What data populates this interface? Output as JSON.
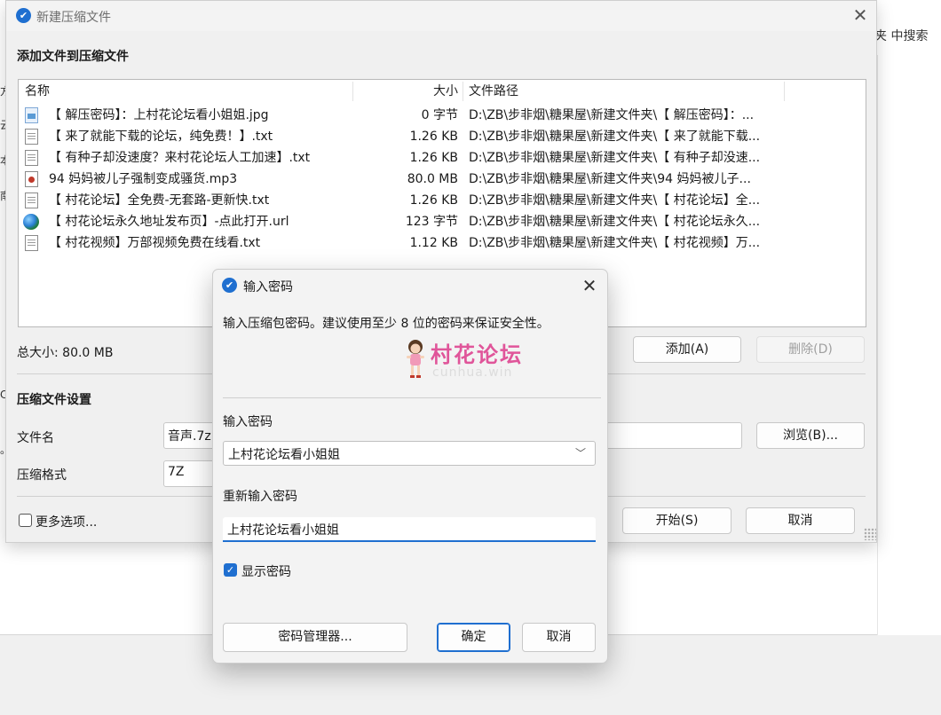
{
  "background": {
    "search_text": "夹 中搜索",
    "left_glyphs": [
      "方",
      "云",
      "本",
      "南",
      "C",
      "。"
    ]
  },
  "main_window": {
    "title": "新建压缩文件",
    "close_glyph": "✕",
    "logo_glyph": "✔",
    "add_files_header": "添加文件到压缩文件",
    "columns": {
      "name": "名称",
      "size": "大小",
      "path": "文件路径"
    },
    "files": [
      {
        "icon": "image-file-icon",
        "name": "【 解压密码】：上村花论坛看小姐姐.jpg",
        "size": "0 字节",
        "path": "D:\\ZB\\步非烟\\糖果屋\\新建文件夹\\【 解压密码】：..."
      },
      {
        "icon": "text-file-icon",
        "name": "【 来了就能下载的论坛，纯免费！】.txt",
        "size": "1.26 KB",
        "path": "D:\\ZB\\步非烟\\糖果屋\\新建文件夹\\【 来了就能下载..."
      },
      {
        "icon": "text-file-icon",
        "name": "【 有种子却没速度？来村花论坛人工加速】.txt",
        "size": "1.26 KB",
        "path": "D:\\ZB\\步非烟\\糖果屋\\新建文件夹\\【 有种子却没速..."
      },
      {
        "icon": "audio-file-icon",
        "name": "94 妈妈被儿子强制变成骚货.mp3",
        "size": "80.0 MB",
        "path": "D:\\ZB\\步非烟\\糖果屋\\新建文件夹\\94 妈妈被儿子..."
      },
      {
        "icon": "text-file-icon",
        "name": "【 村花论坛】全免费-无套路-更新快.txt",
        "size": "1.26 KB",
        "path": "D:\\ZB\\步非烟\\糖果屋\\新建文件夹\\【 村花论坛】全..."
      },
      {
        "icon": "globe-icon",
        "name": "【 村花论坛永久地址发布页】-点此打开.url",
        "size": "123 字节",
        "path": "D:\\ZB\\步非烟\\糖果屋\\新建文件夹\\【 村花论坛永久..."
      },
      {
        "icon": "text-file-icon",
        "name": "【 村花视频】万部视频免费在线看.txt",
        "size": "1.12 KB",
        "path": "D:\\ZB\\步非烟\\糖果屋\\新建文件夹\\【 村花视频】万..."
      }
    ],
    "total_size": "总大小: 80.0 MB",
    "add_button": "添加(A)",
    "delete_button": "删除(D)",
    "settings_header": "压缩文件设置",
    "filename_label": "文件名",
    "filename_value": "音声.7z",
    "browse_button": "浏览(B)...",
    "format_label": "压缩格式",
    "format_value": "7Z",
    "more_options_label": "更多选项...",
    "start_button": "开始(S)",
    "cancel_button": "取消"
  },
  "password_dialog": {
    "title": "输入密码",
    "close_glyph": "✕",
    "description": "输入压缩包密码。建议使用至少 8 位的密码来保证安全性。",
    "watermark_text": "村花论坛",
    "watermark_sub": "cunhua.win",
    "password_label": "输入密码",
    "password_value": "上村花论坛看小姐姐",
    "dropdown_glyph": "﹀",
    "reenter_label": "重新输入密码",
    "reenter_value": "上村花论坛看小姐姐",
    "show_password_label": "显示密码",
    "show_password_checked": true,
    "check_glyph": "✓",
    "manager_button": "密码管理器...",
    "ok_button": "确定",
    "cancel_button": "取消"
  },
  "colors": {
    "accent": "#1f6fd0",
    "watermark_pink": "#e0559a"
  }
}
